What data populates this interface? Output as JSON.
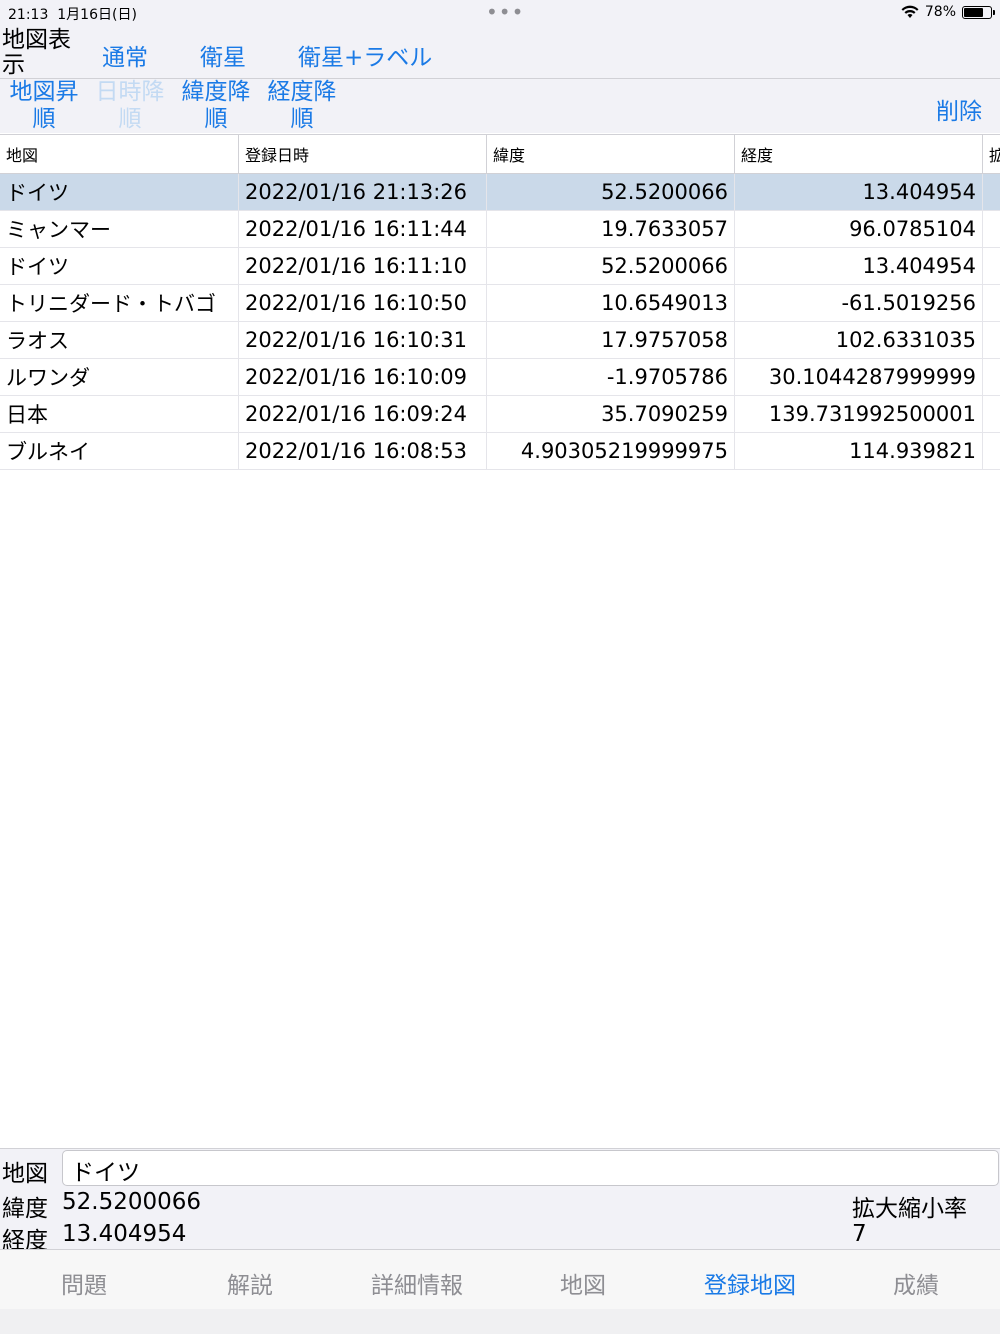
{
  "status": {
    "time": "21:13",
    "date": "1月16日(日)",
    "battery": "78%",
    "battery_level": 0.78
  },
  "map_display": {
    "label": "地図表示",
    "options": [
      "通常",
      "衛星",
      "衛星+ラベル"
    ]
  },
  "sort": {
    "buttons": [
      {
        "label": "地図昇順",
        "enabled": true
      },
      {
        "label": "日時降順",
        "enabled": false
      },
      {
        "label": "緯度降順",
        "enabled": true
      },
      {
        "label": "経度降順",
        "enabled": true
      }
    ],
    "delete_label": "削除"
  },
  "table": {
    "headers": [
      "地図",
      "登録日時",
      "緯度",
      "経度",
      "拡"
    ],
    "rows": [
      [
        "ドイツ",
        "2022/01/16 21:13:26",
        "52.5200066",
        "13.404954"
      ],
      [
        "ミャンマー",
        "2022/01/16 16:11:44",
        "19.7633057",
        "96.0785104"
      ],
      [
        "ドイツ",
        "2022/01/16 16:11:10",
        "52.5200066",
        "13.404954"
      ],
      [
        "トリニダード・トバゴ",
        "2022/01/16 16:10:50",
        "10.6549013",
        "-61.5019256"
      ],
      [
        "ラオス",
        "2022/01/16 16:10:31",
        "17.9757058",
        "102.6331035"
      ],
      [
        "ルワンダ",
        "2022/01/16 16:10:09",
        "-1.9705786",
        "30.1044287999999"
      ],
      [
        "日本",
        "2022/01/16 16:09:24",
        "35.7090259",
        "139.731992500001"
      ],
      [
        "ブルネイ",
        "2022/01/16 16:08:53",
        "4.90305219999975",
        "114.939821"
      ]
    ]
  },
  "detail": {
    "map_label": "地図",
    "map_value": "ドイツ",
    "lat_label": "緯度",
    "lat_value": "52.5200066",
    "lng_label": "経度",
    "lng_value": "13.404954",
    "zoom_label": "拡大縮小率",
    "zoom_value": "7"
  },
  "tabs": [
    {
      "label": "問題",
      "active": false
    },
    {
      "label": "解説",
      "active": false
    },
    {
      "label": "詳細情報",
      "active": false
    },
    {
      "label": "地図",
      "active": false
    },
    {
      "label": "登録地図",
      "active": true
    },
    {
      "label": "成績",
      "active": false
    }
  ],
  "colors": {
    "accent": "#1a7ae6",
    "selected_row": "#cad9e9",
    "inactive_tab": "#8e8e93"
  }
}
